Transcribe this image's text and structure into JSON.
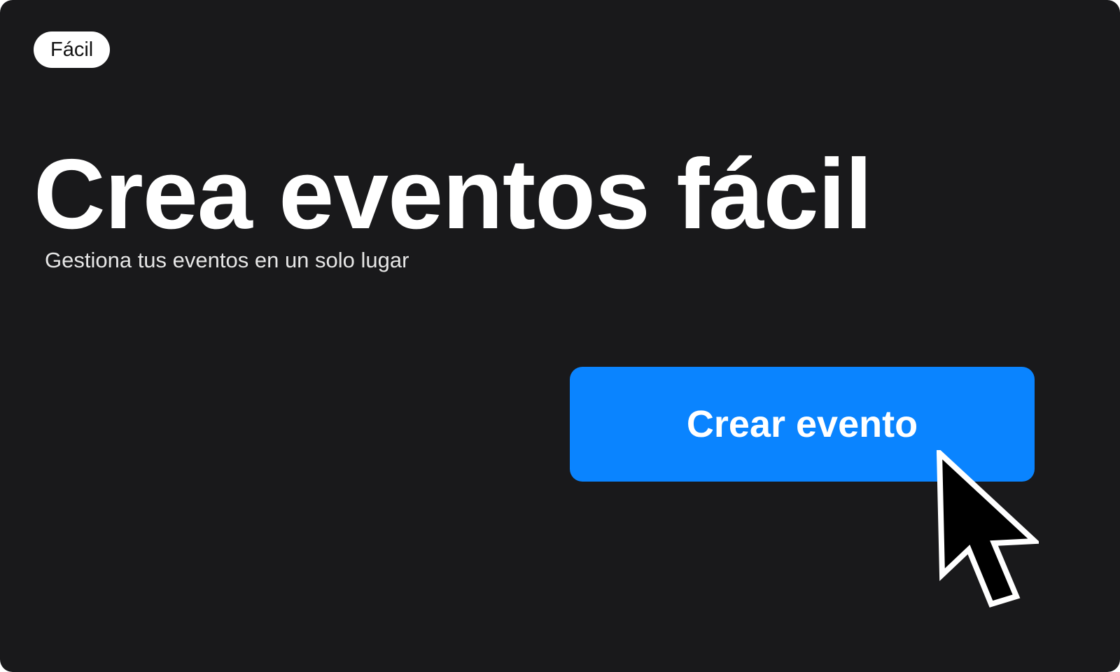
{
  "badge": {
    "label": "Fácil"
  },
  "hero": {
    "title": "Crea eventos fácil",
    "subtitle": "Gestiona tus eventos en un solo lugar"
  },
  "cta": {
    "label": "Crear evento"
  },
  "pointer": {
    "icon": "mouse-pointer-icon"
  },
  "colors": {
    "background": "#19191b",
    "accent": "#0a84ff",
    "text": "#ffffff",
    "badge_background": "#ffffff"
  }
}
